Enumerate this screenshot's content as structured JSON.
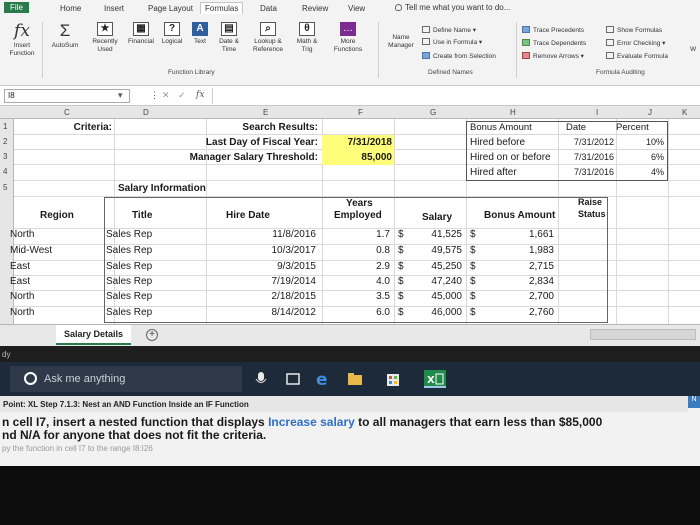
{
  "tabs": [
    "File",
    "Home",
    "Insert",
    "Page Layout",
    "Formulas",
    "Data",
    "Review",
    "View"
  ],
  "tell_me": "Tell me what you want to do...",
  "ribbon": {
    "insert_function": [
      "Insert",
      "Function"
    ],
    "autosum": "AutoSum",
    "recently_used": [
      "Recently",
      "Used"
    ],
    "financial": "Financial",
    "logical": "Logical",
    "text": "Text",
    "date_time": [
      "Date &",
      "Time"
    ],
    "lookup": [
      "Lookup &",
      "Reference"
    ],
    "math": [
      "Math &",
      "Trig"
    ],
    "more": [
      "More",
      "Functions"
    ],
    "function_library": "Function Library",
    "name_manager": [
      "Name",
      "Manager"
    ],
    "define_name": "Define Name",
    "use_in_formula": "Use in Formula",
    "create_from_selection": "Create from Selection",
    "defined_names": "Defined Names",
    "trace_precedents": "Trace Precedents",
    "trace_dependents": "Trace Dependents",
    "remove_arrows": "Remove Arrows",
    "show_formulas": "Show Formulas",
    "error_checking": "Error Checking",
    "evaluate_formula": "Evaluate Formula",
    "formula_auditing": "Formula Auditing",
    "watch": "W"
  },
  "formula_bar": {
    "name_box": "I8",
    "fx": "fx"
  },
  "columns": [
    "C",
    "D",
    "E",
    "F",
    "G",
    "H",
    "I",
    "J",
    "K"
  ],
  "rows": [
    "1",
    "2",
    "3",
    "4",
    "5",
    "6",
    "7",
    "8",
    "9",
    "10",
    "11",
    "12"
  ],
  "criteria": {
    "label": "Criteria:",
    "search_results": "Search Results:",
    "last_day": "Last Day of Fiscal Year:",
    "last_day_value": "7/31/2018",
    "threshold": "Manager Salary Threshold:",
    "threshold_sym": "$",
    "threshold_value": "85,000",
    "bonus_amount": "Bonus Amount",
    "date": "Date",
    "percent": "Percent",
    "bonus_rows": [
      {
        "label": "Hired before",
        "date": "7/31/2012",
        "pct": "10%"
      },
      {
        "label": "Hired on or before",
        "date": "7/31/2016",
        "pct": "6%"
      },
      {
        "label": "Hired after",
        "date": "7/31/2016",
        "pct": "4%"
      }
    ]
  },
  "salary_info": "Salary Information",
  "table": {
    "headers": {
      "region": "Region",
      "title": "Title",
      "hire_date": "Hire Date",
      "years": [
        "Years",
        "Employed"
      ],
      "salary": "Salary",
      "bonus": "Bonus Amount",
      "raise": [
        "Raise",
        "Status"
      ]
    },
    "rows": [
      {
        "region": "North",
        "title": "Sales Rep",
        "hire": "11/8/2016",
        "years": "1.7",
        "salary": "41,525",
        "bonus": "1,661"
      },
      {
        "region": "Mid-West",
        "title": "Sales Rep",
        "hire": "10/3/2017",
        "years": "0.8",
        "salary": "49,575",
        "bonus": "1,983"
      },
      {
        "region": "East",
        "title": "Sales Rep",
        "hire": "9/3/2015",
        "years": "2.9",
        "salary": "45,250",
        "bonus": "2,715"
      },
      {
        "region": "East",
        "title": "Sales Rep",
        "hire": "7/19/2014",
        "years": "4.0",
        "salary": "47,240",
        "bonus": "2,834"
      },
      {
        "region": "North",
        "title": "Sales Rep",
        "hire": "2/18/2015",
        "years": "3.5",
        "salary": "45,000",
        "bonus": "2,700"
      },
      {
        "region": "North",
        "title": "Sales Rep",
        "hire": "8/14/2012",
        "years": "6.0",
        "salary": "46,000",
        "bonus": "2,760"
      }
    ],
    "dollar": "$"
  },
  "sheet_tab": "Salary Details",
  "status": "dy",
  "taskbar": {
    "search_placeholder": "Ask me anything"
  },
  "panel": {
    "head": "Point: XL Step 7.1.3: Nest an AND Function Inside an IF Function",
    "side": "N",
    "line1_a": "n cell I7, insert a nested function that displays ",
    "line1_hl": "Increase salary",
    "line1_b": " to all managers that earn less than $85,000",
    "line2": "nd N/A for anyone that does not fit the criteria.",
    "hint": "py the function in cell I7 to the range I8:I26"
  }
}
